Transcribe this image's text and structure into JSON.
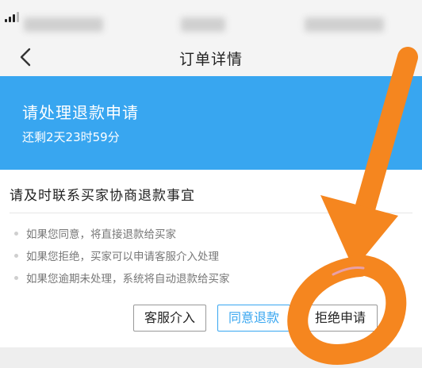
{
  "nav": {
    "title": "订单详情"
  },
  "banner": {
    "title": "请处理退款申请",
    "timer": "还剩2天23时59分",
    "color": "#38a6f0"
  },
  "card": {
    "heading": "请及时联系买家协商退款事宜",
    "tips": [
      "如果您同意，将直接退款给买家",
      "如果您拒绝，买家可以申请客服介入处理",
      "如果您逾期未处理，系统将自动退款给买家"
    ]
  },
  "actions": {
    "service": "客服介入",
    "agree": "同意退款",
    "reject": "拒绝申请"
  },
  "icons": {
    "back": "back-chevron-icon",
    "signal": "signal-strength-icon",
    "annotation": "orange-arrow-annotation"
  },
  "colors": {
    "accent": "#38a6f0",
    "annotation": "#f5861f"
  }
}
